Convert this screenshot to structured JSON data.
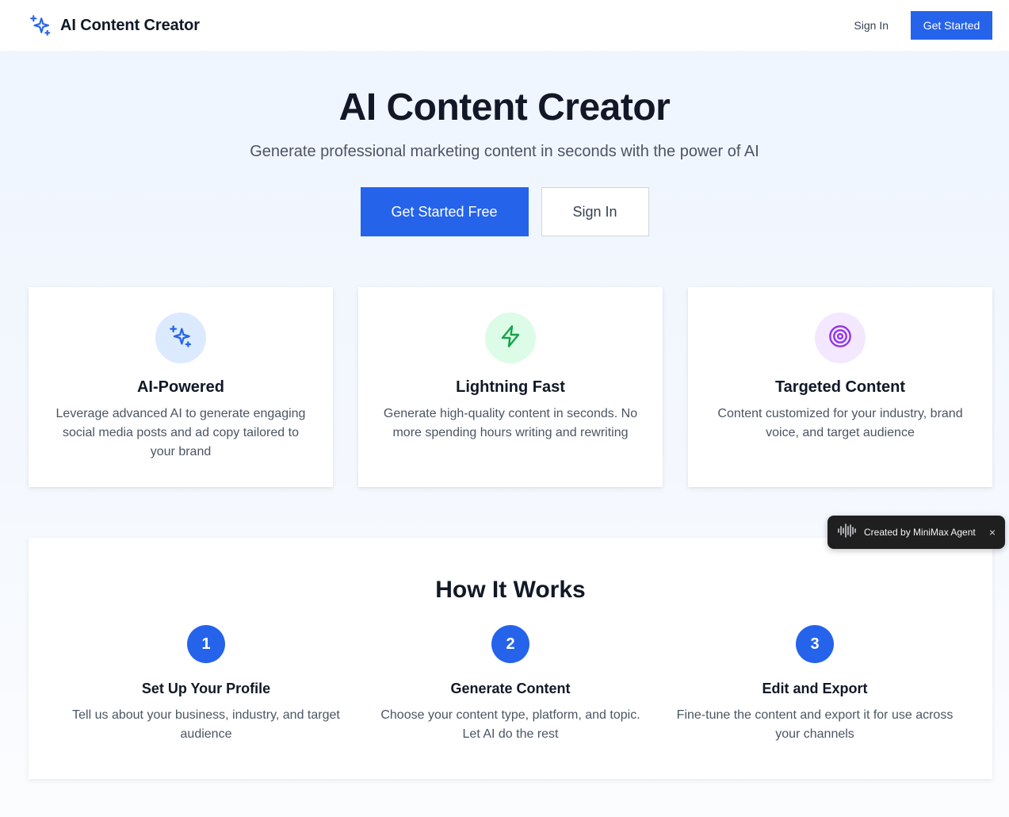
{
  "navbar": {
    "brand_title": "AI Content Creator",
    "brand_icon": "sparkles-icon",
    "signin_label": "Sign In",
    "getstarted_label": "Get Started"
  },
  "hero": {
    "title": "AI Content Creator",
    "subtitle": "Generate professional marketing content in seconds with the power of AI",
    "primary_cta": "Get Started Free",
    "secondary_cta": "Sign In"
  },
  "features": [
    {
      "icon": "sparkles-icon",
      "title": "AI-Powered",
      "description": "Leverage advanced AI to generate engaging social media posts and ad copy tailored to your brand",
      "icon_color": "#2563eb",
      "icon_bg": "#dbeafe"
    },
    {
      "icon": "lightning-icon",
      "title": "Lightning Fast",
      "description": "Generate high-quality content in seconds. No more spending hours writing and rewriting",
      "icon_color": "#16a34a",
      "icon_bg": "#dcfce7"
    },
    {
      "icon": "target-icon",
      "title": "Targeted Content",
      "description": "Content customized for your industry, brand voice, and target audience",
      "icon_color": "#9333ea",
      "icon_bg": "#f3e8ff"
    }
  ],
  "how_it_works": {
    "title": "How It Works",
    "steps": [
      {
        "number": "1",
        "title": "Set Up Your Profile",
        "description": "Tell us about your business, industry, and target audience"
      },
      {
        "number": "2",
        "title": "Generate Content",
        "description": "Choose your content type, platform, and topic. Let AI do the rest"
      },
      {
        "number": "3",
        "title": "Edit and Export",
        "description": "Fine-tune the content and export it for use across your channels"
      }
    ]
  },
  "badge": {
    "text": "Created by MiniMax Agent",
    "icon": "waveform-icon",
    "close_label": "×"
  },
  "colors": {
    "accent": "#2563eb",
    "text_primary": "#111827",
    "text_secondary": "#4b5563"
  }
}
